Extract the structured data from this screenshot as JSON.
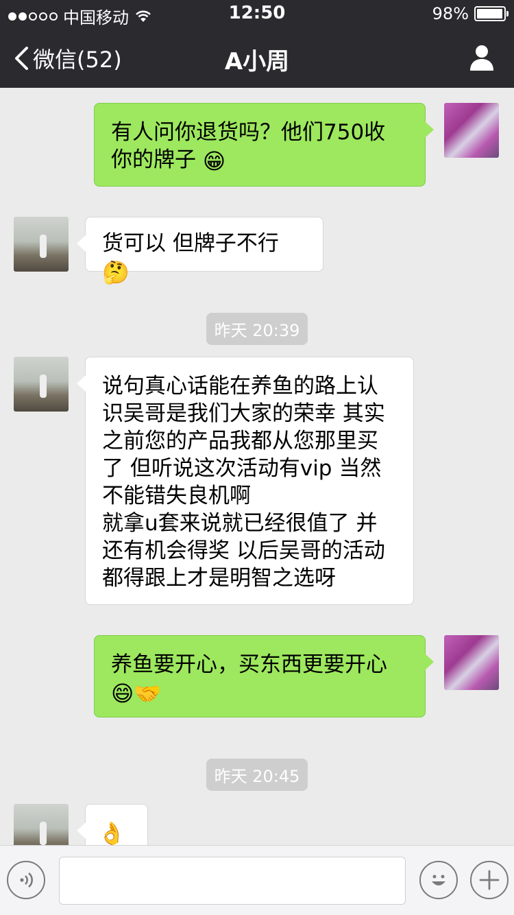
{
  "status_bar": {
    "carrier": "中国移动",
    "time": "12:50",
    "battery": "98%",
    "battery_level": 0.98
  },
  "nav": {
    "back_label": "微信(52)",
    "title": "A小周"
  },
  "messages": [
    {
      "side": "out",
      "lines": [
        "有人问你退货吗？他们750收",
        "你的牌子"
      ],
      "emoji": "😁"
    },
    {
      "side": "in",
      "lines": [
        "货可以 但牌子不行"
      ],
      "emoji": "🤔"
    },
    {
      "side": "in",
      "lines": [
        "说句真心话能在养鱼的路上认",
        "识吴哥是我们大家的荣幸  其实",
        "之前您的产品我都从您那里买",
        "了  但听说这次活动有vip  当然",
        "不能错失良机啊",
        "就拿u套来说就已经很值了 并",
        "还有机会得奖  以后吴哥的活动",
        "都得跟上才是明智之选呀"
      ]
    },
    {
      "side": "out",
      "lines": [
        "养鱼要开心，买东西更要开心"
      ],
      "emoji": "😄🤝"
    },
    {
      "side": "in",
      "lines": [],
      "emoji": "👌"
    }
  ],
  "timestamps": [
    "昨天 20:39",
    "昨天 20:45"
  ],
  "input_bar": {
    "voice_icon": "voice-icon",
    "emoji_icon": "emoji-face-icon",
    "plus_icon": "plus-icon"
  }
}
